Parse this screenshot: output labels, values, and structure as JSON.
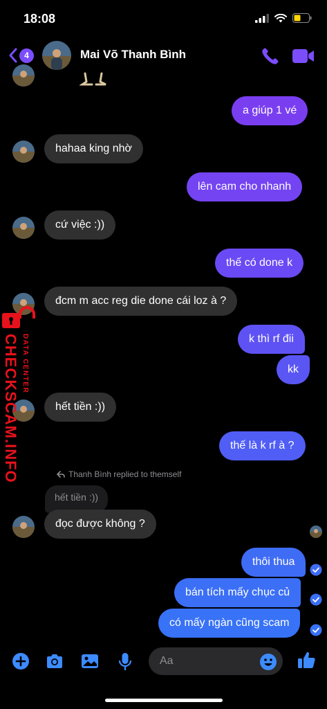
{
  "status_bar": {
    "time": "18:08"
  },
  "header": {
    "back_badge": "4",
    "contact_name": "Mai Võ Thanh Bình"
  },
  "messages": [
    {
      "side": "out",
      "text": "a giúp 1 vé"
    },
    {
      "side": "in",
      "text": "hahaa king nhờ"
    },
    {
      "side": "out",
      "text": "lên cam cho nhanh"
    },
    {
      "side": "in",
      "text": "cứ việc :))"
    },
    {
      "side": "out",
      "text": "thế có done k"
    },
    {
      "side": "in",
      "text": "đcm m acc reg die done cái loz à ?"
    },
    {
      "side": "out",
      "text": "k thì rf đii"
    },
    {
      "side": "out",
      "text": "kk"
    },
    {
      "side": "in",
      "text": "hết tiền :))"
    },
    {
      "side": "out",
      "text": "thế là k rf à ?"
    },
    {
      "side": "in",
      "text": "đọc được không ?"
    },
    {
      "side": "out",
      "text": "thôi thua"
    },
    {
      "side": "out",
      "text": "bán tích mấy chục củ"
    },
    {
      "side": "out",
      "text": "có mấy ngàn cũng scam"
    }
  ],
  "reply": {
    "note": "Thanh Bình replied to themself",
    "quoted": "hết tiền :))"
  },
  "watermark": {
    "main": "CHECKSCAM.INFO",
    "sub": "DATA CENTER"
  },
  "composer": {
    "placeholder": "Aa"
  },
  "colors": {
    "accent": "#7b4dff",
    "incoming": "#303030",
    "outgoing_top": "#7b3df0",
    "outgoing_bottom": "#3d6df5",
    "watermark": "#e8121c"
  },
  "icons": [
    "back-chevron-icon",
    "phone-icon",
    "video-camera-icon",
    "plus-icon",
    "camera-icon",
    "image-icon",
    "microphone-icon",
    "emoji-icon",
    "thumbs-up-icon",
    "read-check-icon",
    "reply-arrow-icon",
    "lock-icon"
  ]
}
